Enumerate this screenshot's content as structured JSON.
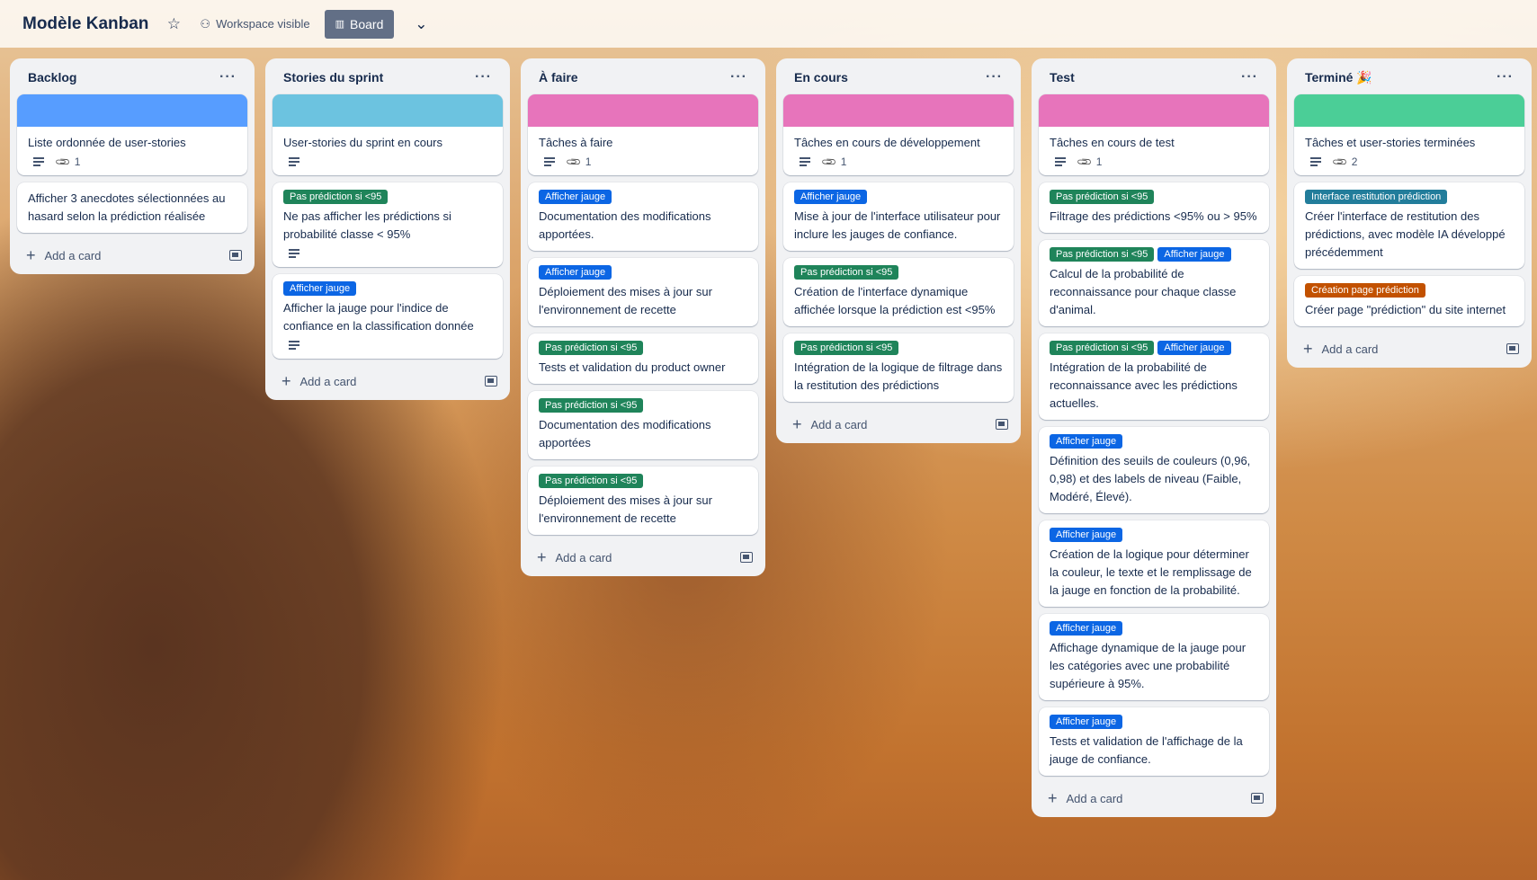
{
  "header": {
    "board_title": "Modèle Kanban",
    "visibility": "Workspace visible",
    "view": "Board"
  },
  "add_card_label": "Add a card",
  "label_colors": {
    "green": "#1f845a",
    "blue": "#0c66e4",
    "teal": "#227d9b",
    "orange": "#c25100"
  },
  "lists": [
    {
      "title": "Backlog",
      "cards": [
        {
          "cover": "#579dff",
          "title": "Liste ordonnée de user-stories",
          "desc": true,
          "attachments": "1"
        },
        {
          "title": "Afficher 3 anecdotes sélectionnées au hasard selon la prédiction réalisée"
        }
      ]
    },
    {
      "title": "Stories du sprint",
      "cards": [
        {
          "cover": "#6cc3e0",
          "title": "User-stories du sprint en cours",
          "desc": true
        },
        {
          "labels": [
            {
              "text": "Pas prédiction si <95",
              "color": "green"
            }
          ],
          "title": "Ne pas afficher les prédictions si probabilité classe < 95%",
          "desc": true
        },
        {
          "labels": [
            {
              "text": "Afficher jauge",
              "color": "blue"
            }
          ],
          "title": "Afficher la jauge pour l'indice de confiance en la classification donnée",
          "desc": true
        }
      ]
    },
    {
      "title": "À faire",
      "cards": [
        {
          "cover": "#e774bb",
          "title": "Tâches à faire",
          "desc": true,
          "attachments": "1"
        },
        {
          "labels": [
            {
              "text": "Afficher jauge",
              "color": "blue"
            }
          ],
          "title": "Documentation des modifications apportées."
        },
        {
          "labels": [
            {
              "text": "Afficher jauge",
              "color": "blue"
            }
          ],
          "title": "Déploiement des mises à jour sur l'environnement de recette"
        },
        {
          "labels": [
            {
              "text": "Pas prédiction si <95",
              "color": "green"
            }
          ],
          "title": "Tests et validation du product owner"
        },
        {
          "labels": [
            {
              "text": "Pas prédiction si <95",
              "color": "green"
            }
          ],
          "title": "Documentation des modifications apportées"
        },
        {
          "labels": [
            {
              "text": "Pas prédiction si <95",
              "color": "green"
            }
          ],
          "title": "Déploiement des mises à jour sur l'environnement de recette"
        }
      ]
    },
    {
      "title": "En cours",
      "cards": [
        {
          "cover": "#e774bb",
          "title": "Tâches en cours de développement",
          "desc": true,
          "attachments": "1"
        },
        {
          "labels": [
            {
              "text": "Afficher jauge",
              "color": "blue"
            }
          ],
          "title": "Mise à jour de l'interface utilisateur pour inclure les jauges de confiance."
        },
        {
          "labels": [
            {
              "text": "Pas prédiction si <95",
              "color": "green"
            }
          ],
          "title": "Création de l'interface dynamique affichée lorsque la prédiction est <95%"
        },
        {
          "labels": [
            {
              "text": "Pas prédiction si <95",
              "color": "green"
            }
          ],
          "title": "Intégration de la logique de filtrage dans la restitution des prédictions"
        }
      ]
    },
    {
      "title": "Test",
      "cards": [
        {
          "cover": "#e774bb",
          "title": "Tâches en cours de test",
          "desc": true,
          "attachments": "1"
        },
        {
          "labels": [
            {
              "text": "Pas prédiction si <95",
              "color": "green"
            }
          ],
          "title": "Filtrage des prédictions <95% ou > 95%"
        },
        {
          "labels": [
            {
              "text": "Pas prédiction si <95",
              "color": "green"
            },
            {
              "text": "Afficher jauge",
              "color": "blue"
            }
          ],
          "title": "Calcul de la probabilité de reconnaissance pour chaque classe d'animal."
        },
        {
          "labels": [
            {
              "text": "Pas prédiction si <95",
              "color": "green"
            },
            {
              "text": "Afficher jauge",
              "color": "blue"
            }
          ],
          "title": "Intégration de la probabilité de reconnaissance avec les prédictions actuelles."
        },
        {
          "labels": [
            {
              "text": "Afficher jauge",
              "color": "blue"
            }
          ],
          "title": "Définition des seuils de couleurs (0,96, 0,98) et des labels de niveau (Faible, Modéré, Élevé)."
        },
        {
          "labels": [
            {
              "text": "Afficher jauge",
              "color": "blue"
            }
          ],
          "title": "Création de la logique pour déterminer la couleur, le texte et le remplissage de la jauge en fonction de la probabilité."
        },
        {
          "labels": [
            {
              "text": "Afficher jauge",
              "color": "blue"
            }
          ],
          "title": "Affichage dynamique de la jauge pour les catégories avec une probabilité supérieure à 95%."
        },
        {
          "labels": [
            {
              "text": "Afficher jauge",
              "color": "blue"
            }
          ],
          "title": "Tests et validation de l'affichage de la jauge de confiance."
        }
      ]
    },
    {
      "title": "Terminé 🎉",
      "cards": [
        {
          "cover": "#4bce97",
          "title": "Tâches et user-stories terminées",
          "desc": true,
          "attachments": "2"
        },
        {
          "labels": [
            {
              "text": "Interface restitution prédiction",
              "color": "teal"
            }
          ],
          "title": "Créer l'interface de restitution des prédictions, avec modèle IA développé précédemment"
        },
        {
          "labels": [
            {
              "text": "Création page prédiction",
              "color": "orange"
            }
          ],
          "title": "Créer page \"prédiction\" du site internet"
        }
      ]
    }
  ]
}
